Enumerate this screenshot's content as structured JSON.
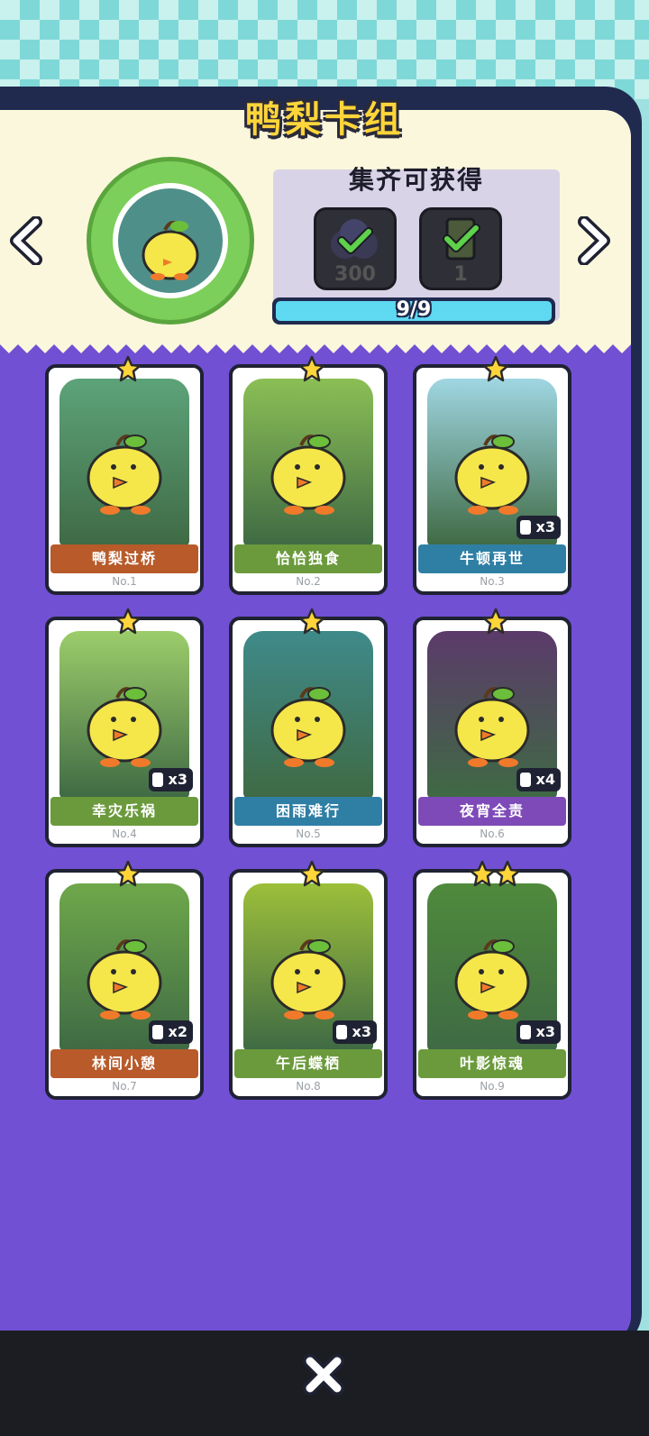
{
  "title": "鸭梨卡组",
  "reward": {
    "title": "集齐可获得",
    "items": [
      {
        "name": "coin-bundle",
        "qty": "300",
        "claimed": true
      },
      {
        "name": "card-pack",
        "qty": "1",
        "claimed": true
      }
    ],
    "progress_text": "9/9",
    "progress": 1.0
  },
  "cards": [
    {
      "name": "鸭梨过桥",
      "no": "No.1",
      "stars": 1,
      "dup": "",
      "banner_color": "#b85a2a",
      "art_color": "#5da37a"
    },
    {
      "name": "恰恰独食",
      "no": "No.2",
      "stars": 1,
      "dup": "",
      "banner_color": "#6b9a3c",
      "art_color": "#8bbf55"
    },
    {
      "name": "牛顿再世",
      "no": "No.3",
      "stars": 1,
      "dup": "x3",
      "banner_color": "#2f7fa5",
      "art_color": "#9fd6e2"
    },
    {
      "name": "幸灾乐祸",
      "no": "No.4",
      "stars": 1,
      "dup": "x3",
      "banner_color": "#6b9a3c",
      "art_color": "#9ccd6a"
    },
    {
      "name": "困雨难行",
      "no": "No.5",
      "stars": 1,
      "dup": "",
      "banner_color": "#2f7fa5",
      "art_color": "#3f8a8a"
    },
    {
      "name": "夜宵全责",
      "no": "No.6",
      "stars": 1,
      "dup": "x4",
      "banner_color": "#7e4ab8",
      "art_color": "#5b3a6a"
    },
    {
      "name": "林间小憩",
      "no": "No.7",
      "stars": 1,
      "dup": "x2",
      "banner_color": "#b85a2a",
      "art_color": "#6ea84a"
    },
    {
      "name": "午后蝶栖",
      "no": "No.8",
      "stars": 1,
      "dup": "x3",
      "banner_color": "#6b9a3c",
      "art_color": "#9cbf3a"
    },
    {
      "name": "叶影惊魂",
      "no": "No.9",
      "stars": 2,
      "dup": "x3",
      "banner_color": "#6b9a3c",
      "art_color": "#4f8a3c"
    }
  ],
  "colors": {
    "title": "#ffd53a",
    "panel_purple": "#7150d4",
    "panel_cream": "#fbf7dc",
    "progress": "#5fd9f2"
  },
  "icons": {
    "prev": "chevron-left-icon",
    "next": "chevron-right-icon",
    "close": "close-icon"
  }
}
